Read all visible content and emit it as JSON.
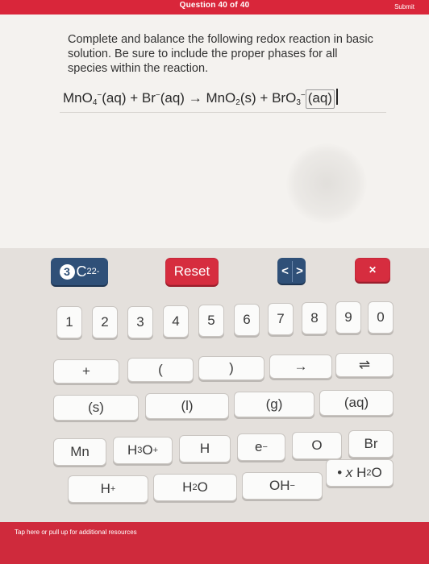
{
  "header": {
    "question_counter": "Question 40 of 40",
    "submit_label": "Submit"
  },
  "question": {
    "prompt": "Complete and balance the following redox reaction in basic solution. Be sure to include the proper phases for all species within the reaction.",
    "equation": {
      "reactant1": {
        "base": "MnO",
        "sub": "4",
        "sup": "−",
        "phase": "(aq)"
      },
      "plus1": "+",
      "reactant2": {
        "base": "Br",
        "sup": "−",
        "phase": "(aq)"
      },
      "arrow": "→",
      "product1": {
        "base": "MnO",
        "sub": "2",
        "phase": "(s)"
      },
      "plus2": "+",
      "product2": {
        "base": "BrO",
        "sub": "3",
        "sup": "−",
        "phase": "(aq)"
      }
    }
  },
  "keypad": {
    "coefficient_key": {
      "coef": "3",
      "base": "C",
      "sub": "2",
      "sup": "2-"
    },
    "reset_label": "Reset",
    "nav_left": "<",
    "nav_right": ">",
    "delete_label": "✕",
    "digits": [
      "1",
      "2",
      "3",
      "4",
      "5",
      "6",
      "7",
      "8",
      "9",
      "0"
    ],
    "symbols": [
      "+",
      "(",
      ")",
      "→",
      "⇌"
    ],
    "phases": [
      "(s)",
      "(l)",
      "(g)",
      "(aq)"
    ],
    "species": {
      "mn": "Mn",
      "h3o": {
        "base": "H",
        "sub": "3",
        "tail": "O",
        "sup": "+"
      },
      "h": "H",
      "e": {
        "base": "e",
        "sup": "−"
      },
      "o": "O",
      "br": "Br",
      "hplus": {
        "base": "H",
        "sup": "+"
      },
      "h2o": {
        "base": "H",
        "sub": "2",
        "tail": "O"
      },
      "oh": {
        "base": "OH",
        "sup": "−"
      },
      "hydrate": {
        "dot": "•",
        "x": "x",
        "base": "H",
        "sub": "2",
        "tail": "O"
      }
    }
  },
  "footer": {
    "hint": "Tap here or pull up for additional resources"
  },
  "colors": {
    "accent_red": "#d62d3f",
    "accent_navy": "#2f5078",
    "key_background": "#fbfbfa",
    "keypad_background": "#e4e0dc"
  }
}
